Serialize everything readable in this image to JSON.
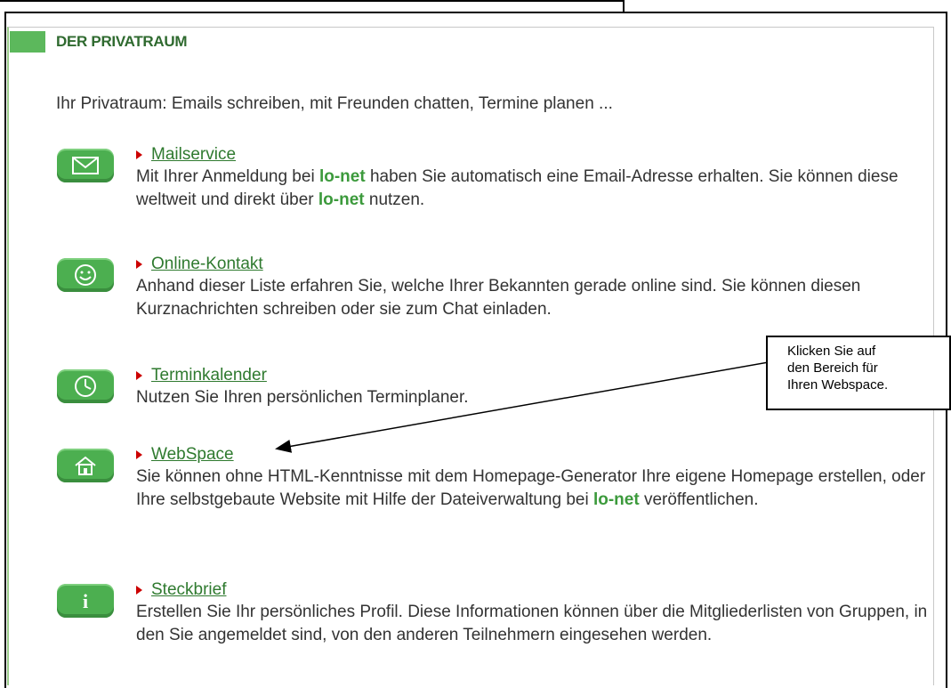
{
  "section_title": "DER PRIVATRAUM",
  "intro_text": "Ihr Privatraum: Emails schreiben, mit Freunden chatten, Termine planen ...",
  "brand_name": "lo-net",
  "colors": {
    "accent_green": "#4caf50",
    "link_green": "#2f7a2f",
    "arrow_red": "#cc0000"
  },
  "items": [
    {
      "icon": "mail-icon",
      "link": "Mailservice",
      "desc_parts": [
        "Mit Ihrer Anmeldung bei ",
        " haben Sie automatisch eine Email-Adresse erhalten. Sie können diese weltweit und direkt über ",
        " nutzen."
      ]
    },
    {
      "icon": "smiley-icon",
      "link": "Online-Kontakt",
      "desc": "Anhand dieser Liste erfahren Sie, welche Ihrer Bekannten gerade online sind. Sie können diesen Kurznachrichten schreiben oder sie zum Chat einladen."
    },
    {
      "icon": "clock-icon",
      "link": "Terminkalender",
      "desc": "Nutzen Sie Ihren persönlichen Terminplaner."
    },
    {
      "icon": "house-icon",
      "link": "WebSpace",
      "desc_parts": [
        "Sie können ohne HTML-Kenntnisse mit dem Homepage-Generator Ihre eigene Homepage erstellen, oder Ihre selbstgebaute Website mit Hilfe der Dateiverwaltung bei ",
        " veröffentlichen."
      ]
    },
    {
      "icon": "info-icon",
      "link": "Steckbrief",
      "desc": "Erstellen Sie Ihr persönliches Profil. Diese Informationen können über die Mitgliederlisten von Gruppen, in den Sie angemeldet sind, von den anderen Teilnehmern eingesehen werden."
    }
  ],
  "callout": {
    "lines": [
      "Klicken Sie auf",
      "den Bereich für",
      "Ihren Webspace."
    ]
  }
}
